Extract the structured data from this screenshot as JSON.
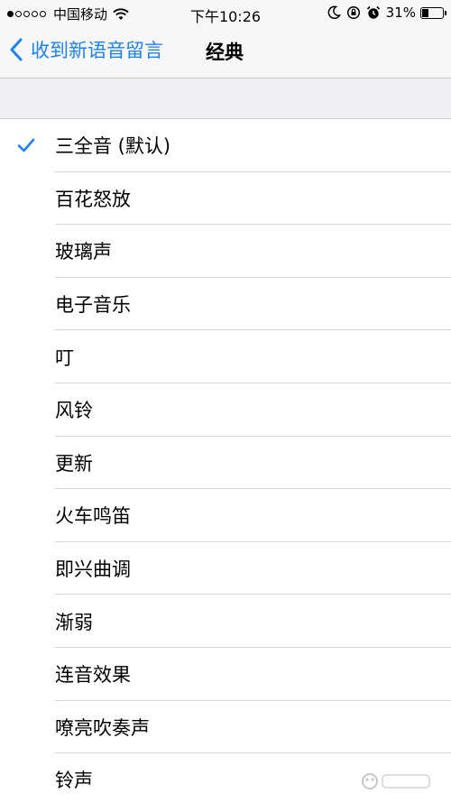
{
  "status_bar": {
    "carrier": "中国移动",
    "time": "下午10:26",
    "battery_percent": "31%",
    "battery_level": 0.31,
    "signal_strength": 1,
    "signal_max": 5
  },
  "nav": {
    "back_label": "收到新语音留言",
    "title": "经典"
  },
  "list": {
    "items": [
      {
        "label": "三全音 (默认)",
        "selected": true
      },
      {
        "label": "百花怒放",
        "selected": false
      },
      {
        "label": "玻璃声",
        "selected": false
      },
      {
        "label": "电子音乐",
        "selected": false
      },
      {
        "label": "叮",
        "selected": false
      },
      {
        "label": "风铃",
        "selected": false
      },
      {
        "label": "更新",
        "selected": false
      },
      {
        "label": "火车鸣笛",
        "selected": false
      },
      {
        "label": "即兴曲调",
        "selected": false
      },
      {
        "label": "渐弱",
        "selected": false
      },
      {
        "label": "连音效果",
        "selected": false
      },
      {
        "label": "嘹亮吹奏声",
        "selected": false
      },
      {
        "label": "铃声",
        "selected": false
      }
    ]
  },
  "colors": {
    "accent": "#1a82f7",
    "bar_background": "#f7f7f7",
    "group_background": "#efeff4"
  },
  "icons": {
    "back": "chevron-left-icon",
    "check": "checkmark-icon",
    "wifi": "wifi-icon",
    "moon": "moon-icon",
    "rotation_lock": "rotation-lock-icon",
    "alarm": "alarm-icon"
  }
}
